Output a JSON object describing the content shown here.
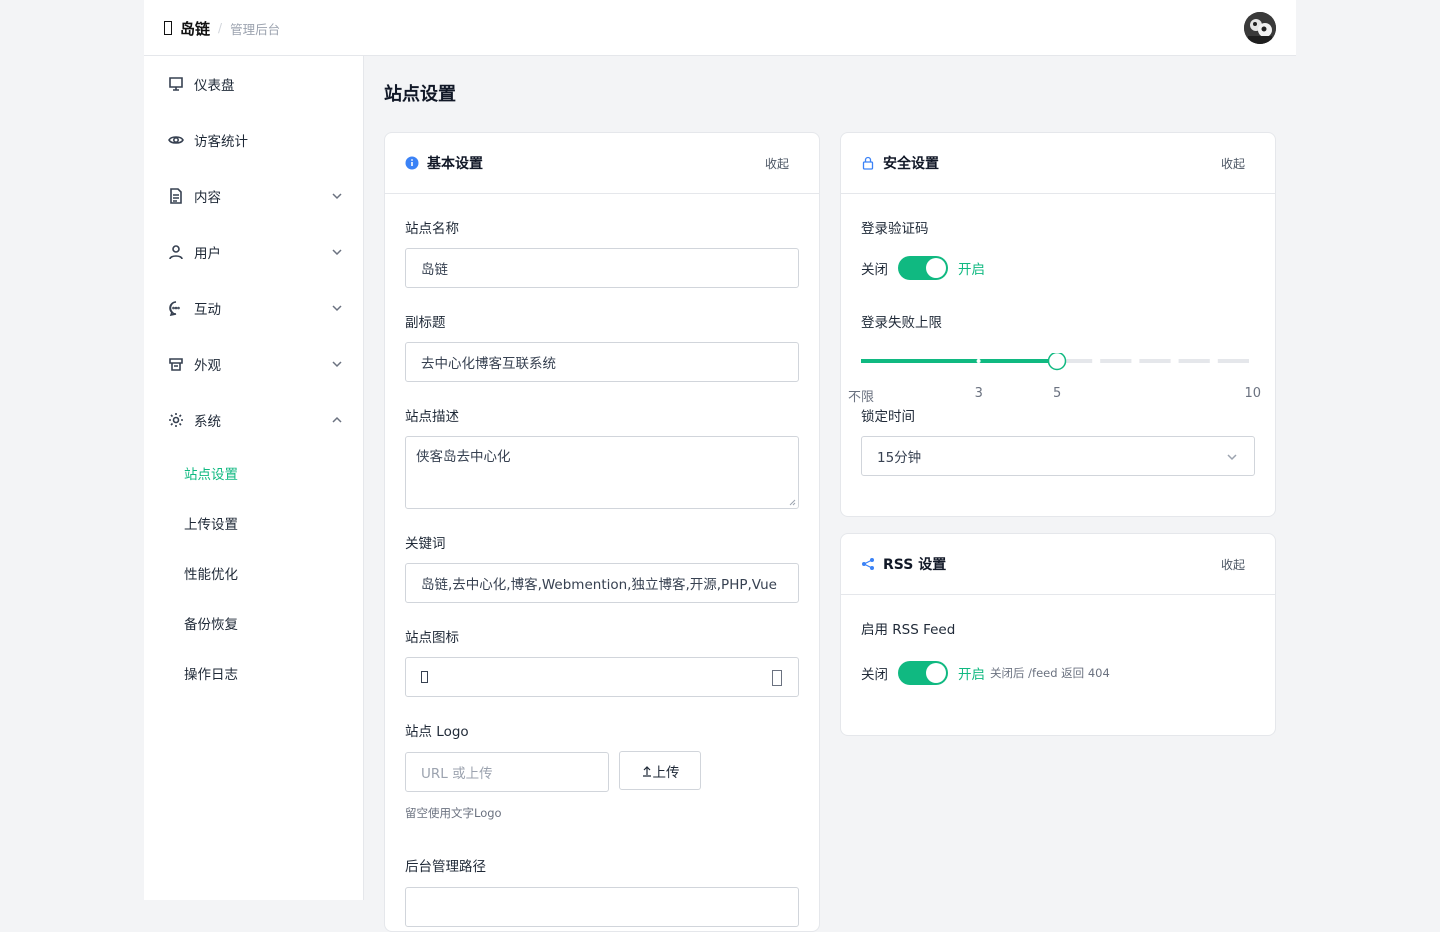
{
  "header": {
    "brand_name": "岛链",
    "separator": "/",
    "brand_sub": "管理后台"
  },
  "sidebar": {
    "items": [
      {
        "label": "仪表盘",
        "icon": "dashboard-icon"
      },
      {
        "label": "访客统计",
        "icon": "eye-icon"
      },
      {
        "label": "内容",
        "icon": "document-icon"
      },
      {
        "label": "用户",
        "icon": "user-icon"
      },
      {
        "label": "互动",
        "icon": "chat-icon"
      },
      {
        "label": "外观",
        "icon": "appearance-icon"
      },
      {
        "label": "系统",
        "icon": "gear-icon"
      }
    ],
    "system_sub": [
      {
        "label": "站点设置",
        "active": true
      },
      {
        "label": "上传设置"
      },
      {
        "label": "性能优化"
      },
      {
        "label": "备份恢复"
      },
      {
        "label": "操作日志"
      }
    ]
  },
  "page": {
    "title": "站点设置"
  },
  "basic": {
    "title": "基本设置",
    "collapse": "收起",
    "site_name_label": "站点名称",
    "site_name_value": "岛链",
    "subtitle_label": "副标题",
    "subtitle_value": "去中心化博客互联系统",
    "desc_label": "站点描述",
    "desc_value": "侠客岛去中心化",
    "keywords_label": "关键词",
    "keywords_value": "岛链,去中心化,博客,Webmention,独立博客,开源,PHP,Vue",
    "icon_label": "站点图标",
    "logo_label": "站点 Logo",
    "logo_placeholder": "URL 或上传",
    "upload_button": "上传",
    "logo_hint": "留空使用文字Logo",
    "admin_path_label": "后台管理路径"
  },
  "security": {
    "title": "安全设置",
    "collapse": "收起",
    "captcha_label": "登录验证码",
    "off_text": "关闭",
    "on_text": "开启",
    "captcha_enabled": true,
    "fail_limit_label": "登录失败上限",
    "fail_limit_value": 5,
    "fail_limit_max": 10,
    "fail_limit_marks": [
      {
        "value": 0,
        "label": "不限"
      },
      {
        "value": 3,
        "label": "3"
      },
      {
        "value": 5,
        "label": "5"
      },
      {
        "value": 10,
        "label": "10"
      }
    ],
    "lock_time_label": "锁定时间",
    "lock_time_value": "15分钟"
  },
  "rss": {
    "title": "RSS 设置",
    "collapse": "收起",
    "enable_label": "启用 RSS Feed",
    "off_text": "关闭",
    "on_text": "开启",
    "enabled": true,
    "hint": "关闭后 /feed 返回 404"
  },
  "colors": {
    "accent": "#10b981",
    "info": "#3b82f6"
  }
}
